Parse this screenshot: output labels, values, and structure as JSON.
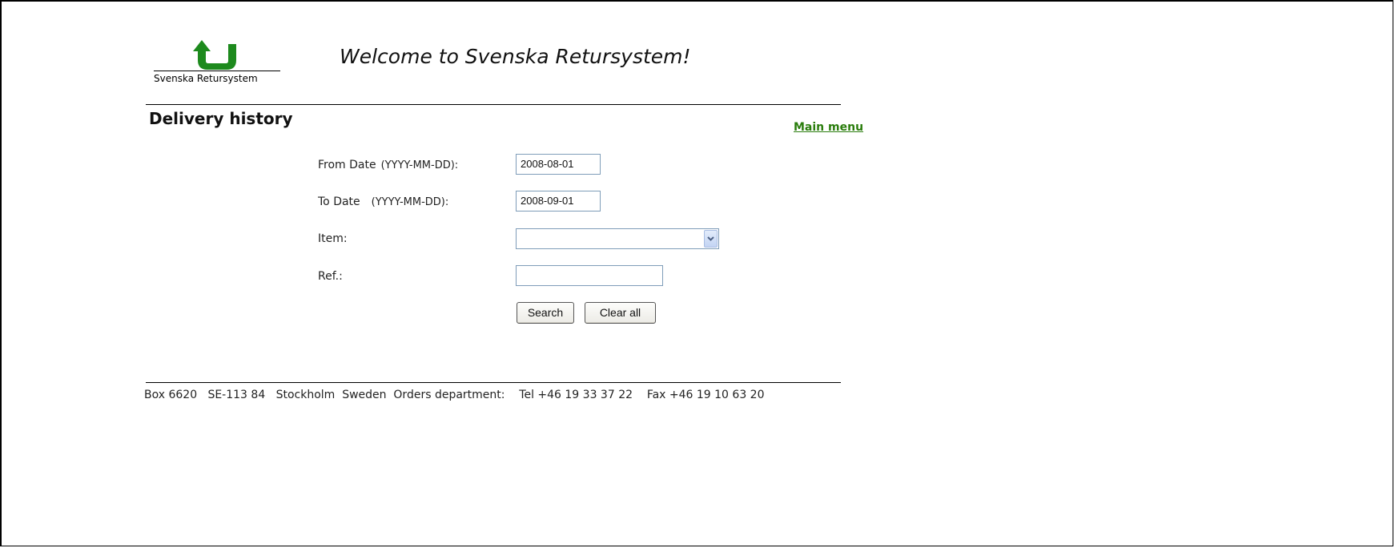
{
  "logo": {
    "text": "Svenska Retursystem",
    "color": "#1d8a1d"
  },
  "header": {
    "welcome": "Welcome to Svenska Retursystem!"
  },
  "page": {
    "title": "Delivery history",
    "main_menu_link": "Main menu",
    "link_color": "#2a7d0c"
  },
  "form": {
    "from_date": {
      "label": "From Date",
      "format": "(YYYY-MM-DD):",
      "value": "2008-08-01"
    },
    "to_date": {
      "label": "To Date",
      "format": "(YYYY-MM-DD):",
      "value": "2008-09-01"
    },
    "item": {
      "label": "Item:",
      "selected": ""
    },
    "ref": {
      "label": "Ref.:",
      "value": ""
    },
    "search_button": "Search",
    "clear_button": "Clear all"
  },
  "footer": {
    "text": "Box 6620   SE-113 84   Stockholm  Sweden  Orders department:    Tel +46 19 33 37 22    Fax +46 19 10 63 20"
  }
}
